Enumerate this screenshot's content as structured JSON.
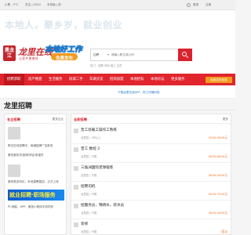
{
  "topbar": {
    "left_items": [
      "小黑 - 5°C",
      "关注 | 2020",
      "手机版 | 前"
    ],
    "right_items": [
      "登录",
      "注册"
    ]
  },
  "hero": {
    "slogan": "本地人，聚乡岁，就业创业"
  },
  "logo": {
    "badge": "黑龙江",
    "name": "龙里在线",
    "sub": "让家乡更美好"
  },
  "ad": {
    "top": "本地好工作",
    "pill": "免费发布"
  },
  "search": {
    "category": "招聘",
    "placeholder": "请输入职位或公司",
    "hint": "热门：招聘 司机 普工 店员"
  },
  "nav": {
    "items": [
      "招聘求职",
      "房产楼盘",
      "生活服务",
      "同城二手",
      "车辆买卖",
      "招商加盟",
      "本地招标",
      "本地论坛",
      "更多服务"
    ],
    "post_button": "免费发布信息"
  },
  "substrip": {
    "tip": "下载龙里在线APP，好工作随时找"
  },
  "page": {
    "title": "龙里招聘"
  },
  "left_panel": {
    "heading": "名企招聘",
    "more": "更多企业",
    "companies": [
      {
        "desc": "职位在线招聘中，商铺招牌广告批发"
      },
      {
        "desc": "餐饮服务员/厨师学徒/收银员"
      },
      {
        "desc": "服务类多岗位，本地直聘直招，正式上班"
      }
    ],
    "banner": "就业招聘·职场服务",
    "footer_text": "PC电脑、APP、微信小程序手机同步"
  },
  "right_panel": {
    "heading": "全职招聘",
    "more": "更多",
    "jobs": [
      {
        "title": "晋工装载工操作工熟练",
        "meta": "龙里县 | 1年以上",
        "salary": "7000-9000元"
      },
      {
        "title": "普工 数控 2",
        "meta": "龙里县 | 不限",
        "salary": "4000-6000元"
      },
      {
        "title": "三角洲国际足球锻炼",
        "meta": "龙里县 | 不限",
        "salary": "3000-5000元"
      },
      {
        "title": "招聘司机",
        "meta": "龙里县 | 不限",
        "salary": "5000-7000元"
      },
      {
        "title": "招服务员，锦绣水，装水员",
        "meta": "龙里县 | 不限",
        "salary": "3000-4000元"
      },
      {
        "title": "装修",
        "meta": "龙里县 | 不限",
        "salary": "面议"
      }
    ]
  }
}
